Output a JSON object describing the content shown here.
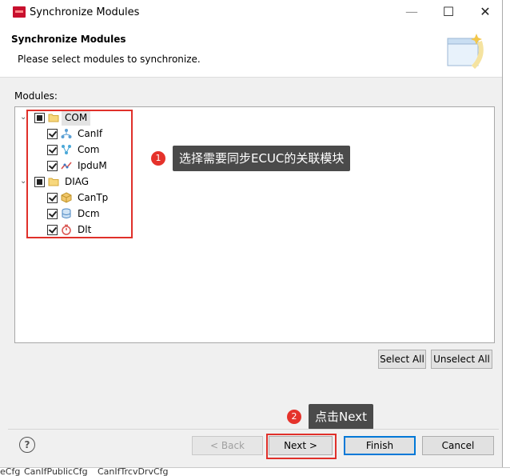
{
  "window": {
    "title": "Synchronize Modules",
    "minimize_glyph": "—",
    "maximize_glyph": "☐",
    "close_glyph": "✕"
  },
  "header": {
    "title": "Synchronize Modules",
    "message": "Please select modules to synchronize."
  },
  "modules_label": "Modules:",
  "tree": [
    {
      "label": "COM",
      "state": "mixed",
      "icon": "folder-icon",
      "children": [
        {
          "label": "CanIf",
          "icon": "network-icon"
        },
        {
          "label": "Com",
          "icon": "com-icon"
        },
        {
          "label": "IpduM",
          "icon": "ipdum-icon"
        }
      ]
    },
    {
      "label": "DIAG",
      "state": "mixed",
      "icon": "folder-icon",
      "children": [
        {
          "label": "CanTp",
          "icon": "package-icon"
        },
        {
          "label": "Dcm",
          "icon": "database-icon"
        },
        {
          "label": "Dlt",
          "icon": "timer-icon"
        }
      ]
    }
  ],
  "callouts": [
    {
      "number": "1",
      "text": "选择需要同步ECUC的关联模块"
    },
    {
      "number": "2",
      "text": "点击Next"
    }
  ],
  "buttons": {
    "select_all": "Select All",
    "unselect_all": "Unselect All",
    "back": "< Back",
    "next": "Next >",
    "finish": "Finish",
    "cancel": "Cancel",
    "help": "?"
  },
  "background_fragments": {
    "bottom": [
      "eCfg",
      "CanIfPublicCfg",
      "CanIfTrcvDrvCfg"
    ]
  },
  "colors": {
    "accent": "#0078d7",
    "highlight": "#e0302a",
    "tooltip_bg": "#4a4a4a",
    "brand": "#c8102e"
  }
}
